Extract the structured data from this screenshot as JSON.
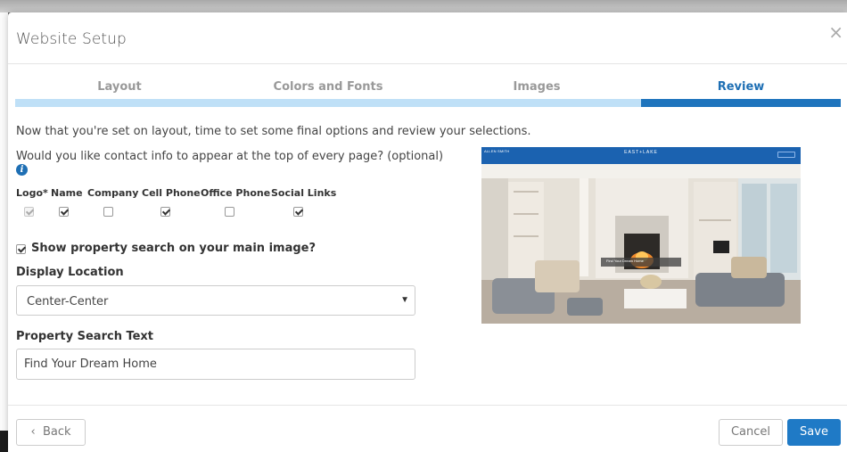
{
  "modal": {
    "title": "Website Setup",
    "close_icon": "close-icon"
  },
  "steps": [
    {
      "label": "Layout",
      "active": false
    },
    {
      "label": "Colors and Fonts",
      "active": false
    },
    {
      "label": "Images",
      "active": false
    },
    {
      "label": "Review",
      "active": true
    }
  ],
  "content": {
    "intro": "Now that you're set on layout, time to set some final options and review your selections.",
    "contact_question": "Would you like contact info to appear at the top of every page? (optional)",
    "info_icon": "info-icon",
    "contact_options": [
      {
        "label": "Logo*",
        "checked": true,
        "disabled": true
      },
      {
        "label": "Name",
        "checked": true,
        "disabled": false
      },
      {
        "label": "Company",
        "checked": false,
        "disabled": false
      },
      {
        "label": "Cell Phone",
        "checked": true,
        "disabled": false
      },
      {
        "label": "Office Phone",
        "checked": false,
        "disabled": false
      },
      {
        "label": "Social Links",
        "checked": true,
        "disabled": false
      }
    ],
    "show_search_label": "Show property search on your main image?",
    "show_search_checked": true,
    "display_location_label": "Display Location",
    "display_location_value": "Center-Center",
    "property_search_label": "Property Search Text",
    "property_search_value": "Find Your Dream Home"
  },
  "preview": {
    "agent_name": "ALLEN SMITH",
    "brand": "EAST+LAKE",
    "search_text": "Find Your Dream Home"
  },
  "footer": {
    "back_label": "Back",
    "cancel_label": "Cancel",
    "save_label": "Save"
  },
  "colors": {
    "accent": "#1e74bd",
    "step_inactive": "#bfe0f7",
    "save_button": "#1f7ac6"
  }
}
